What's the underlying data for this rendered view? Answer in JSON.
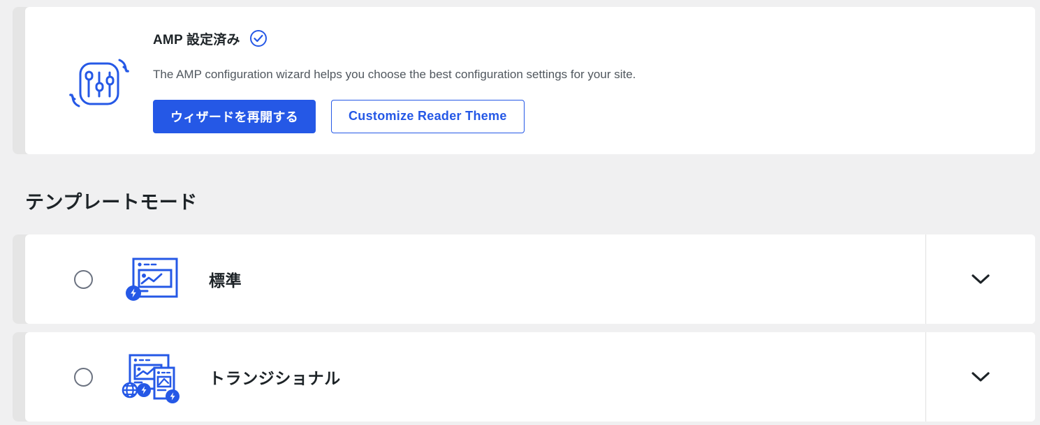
{
  "colors": {
    "page_background": "#f0f0f1",
    "card_background": "#ffffff",
    "accent_blue": "#2558e6",
    "text_dark": "#1d2327",
    "text_muted": "#50575e",
    "card_strip_gray": "#e5e5e5"
  },
  "amp_panel": {
    "icon_name": "amp-settings-sliders-icon",
    "title": "AMP 設定済み",
    "status_icon_name": "circle-check-icon",
    "description": "The AMP configuration wizard helps you choose the best configuration settings for your site.",
    "primary_button": "ウィザードを再開する",
    "secondary_button": "Customize Reader Theme"
  },
  "section": {
    "heading": "テンプレートモード"
  },
  "template_modes": [
    {
      "label": "標準",
      "icon_name": "standard-desktop-amp-icon",
      "selected": false,
      "expanded": false,
      "toggle_icon_name": "chevron-down-icon"
    },
    {
      "label": "トランジショナル",
      "icon_name": "transitional-desktop-mobile-amp-icon",
      "selected": false,
      "expanded": false,
      "toggle_icon_name": "chevron-down-icon"
    }
  ]
}
